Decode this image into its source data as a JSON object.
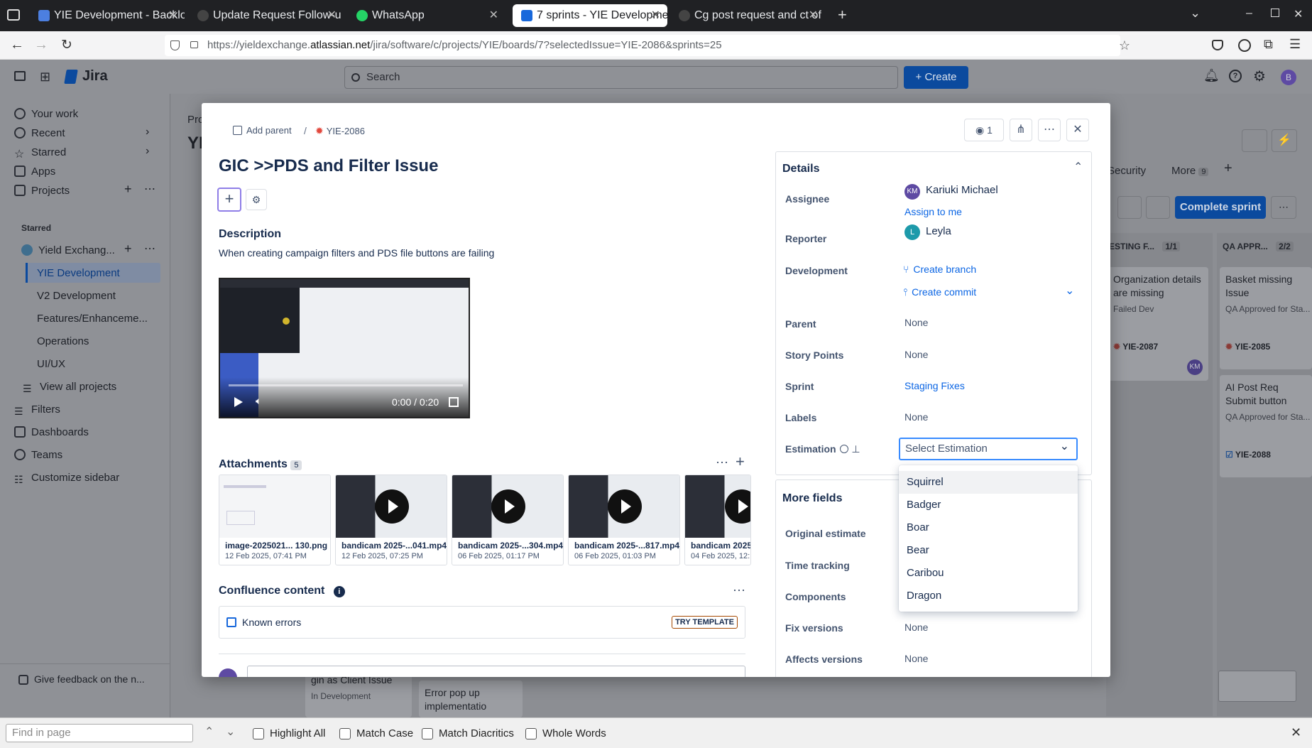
{
  "browser": {
    "tabs": [
      {
        "title": "YIE Development - Backlo",
        "active": false
      },
      {
        "title": "Update Request Follow-u",
        "active": false
      },
      {
        "title": "WhatsApp",
        "active": false
      },
      {
        "title": "7 sprints - YIE Developme",
        "active": true
      },
      {
        "title": "Cg post request and ct of",
        "active": false
      }
    ],
    "url_prefix": "https://yieldexchange.",
    "url_domain": "atlassian.net",
    "url_path": "/jira/software/c/projects/YIE/boards/7?selectedIssue=YIE-2086&sprints=25"
  },
  "jira": {
    "logo": "Jira",
    "search_placeholder": "Search",
    "create_label": "+ Create",
    "avatar": "B",
    "sidebar": {
      "items": [
        "Your work",
        "Recent",
        "Starred",
        "Apps",
        "Projects"
      ],
      "starred_label": "Starred",
      "project": "Yield Exchang...",
      "boards": [
        "YIE Development",
        "V2 Development",
        "Features/Enhanceme...",
        "Operations",
        "UI/UX"
      ],
      "view_all": "View all projects",
      "bottom": [
        "Filters",
        "Dashboards",
        "Teams",
        "Customize sidebar"
      ],
      "feedback": "Give feedback on the n..."
    },
    "board": {
      "crumb": "Pro",
      "title": "YI",
      "security": "Security",
      "more": "More",
      "more_count": "9",
      "complete_sprint": "Complete sprint",
      "col_testing": "ESTING F...",
      "col_testing_count": "1/1",
      "col_qa": "QA APPR...",
      "col_qa_count": "2/2",
      "cards": {
        "org_title": "Organization details are missing",
        "org_status": "Failed Dev",
        "org_key": "YIE-2087",
        "basket_title": "Basket missing Issue",
        "basket_status": "QA Approved for Sta...",
        "basket_key": "YIE-2085",
        "ai_title": "AI Post Req Submit button",
        "ai_status": "QA Approved for Sta...",
        "ai_key": "YIE-2088",
        "login_title": "gin as Client Issue",
        "login_status": "In Development",
        "error_title": "Error pop up implementatio"
      },
      "assignee_initials": "KM"
    }
  },
  "issue": {
    "add_parent": "Add parent",
    "key": "YIE-2086",
    "watch_count": "1",
    "title": "GIC >>PDS and Filter Issue",
    "description_heading": "Description",
    "description_text": "When creating campaign filters and PDS file buttons are failing",
    "video_time": "0:00 / 0:20",
    "attachments_heading": "Attachments",
    "attachments_count": "5",
    "attachments": [
      {
        "name": "image-2025021... 130.png",
        "date": "12 Feb 2025, 07:41 PM",
        "video": false
      },
      {
        "name": "bandicam 2025-...041.mp4",
        "date": "12 Feb 2025, 07:25 PM",
        "video": true
      },
      {
        "name": "bandicam 2025-...304.mp4",
        "date": "06 Feb 2025, 01:17 PM",
        "video": true
      },
      {
        "name": "bandicam 2025-...817.mp4",
        "date": "06 Feb 2025, 01:03 PM",
        "video": true
      },
      {
        "name": "bandicam 2025-...",
        "date": "04 Feb 2025, 12:...",
        "video": true
      }
    ],
    "confluence_heading": "Confluence content",
    "known_errors": "Known errors",
    "try_template": "TRY TEMPLATE",
    "details": {
      "heading": "Details",
      "assignee_label": "Assignee",
      "assignee_initials": "KM",
      "assignee_name": "Kariuki Michael",
      "assign_to_me": "Assign to me",
      "reporter_label": "Reporter",
      "reporter_initial": "L",
      "reporter_name": "Leyla",
      "development_label": "Development",
      "create_branch": "Create branch",
      "create_commit": "Create commit",
      "parent_label": "Parent",
      "parent_value": "None",
      "story_points_label": "Story Points",
      "story_points_value": "None",
      "sprint_label": "Sprint",
      "sprint_value": "Staging Fixes",
      "labels_label": "Labels",
      "labels_value": "None",
      "estimation_label": "Estimation",
      "estimation_placeholder": "Select Estimation",
      "estimation_options": [
        "Squirrel",
        "Badger",
        "Boar",
        "Bear",
        "Caribou",
        "Dragon"
      ]
    },
    "more_fields": {
      "heading": "More fields",
      "original_estimate_label": "Original estimate",
      "time_tracking_label": "Time tracking",
      "components_label": "Components",
      "fix_versions_label": "Fix versions",
      "fix_versions_value": "None",
      "affects_versions_label": "Affects versions",
      "affects_versions_value": "None"
    }
  },
  "findbar": {
    "placeholder": "Find in page",
    "highlight_all": "Highlight All",
    "match_case": "Match Case",
    "match_diacritics": "Match Diacritics",
    "whole_words": "Whole Words"
  },
  "colors": {
    "accent": "#0c66e4",
    "jira_blue": "#1868db",
    "bug_red": "#e2483d"
  }
}
